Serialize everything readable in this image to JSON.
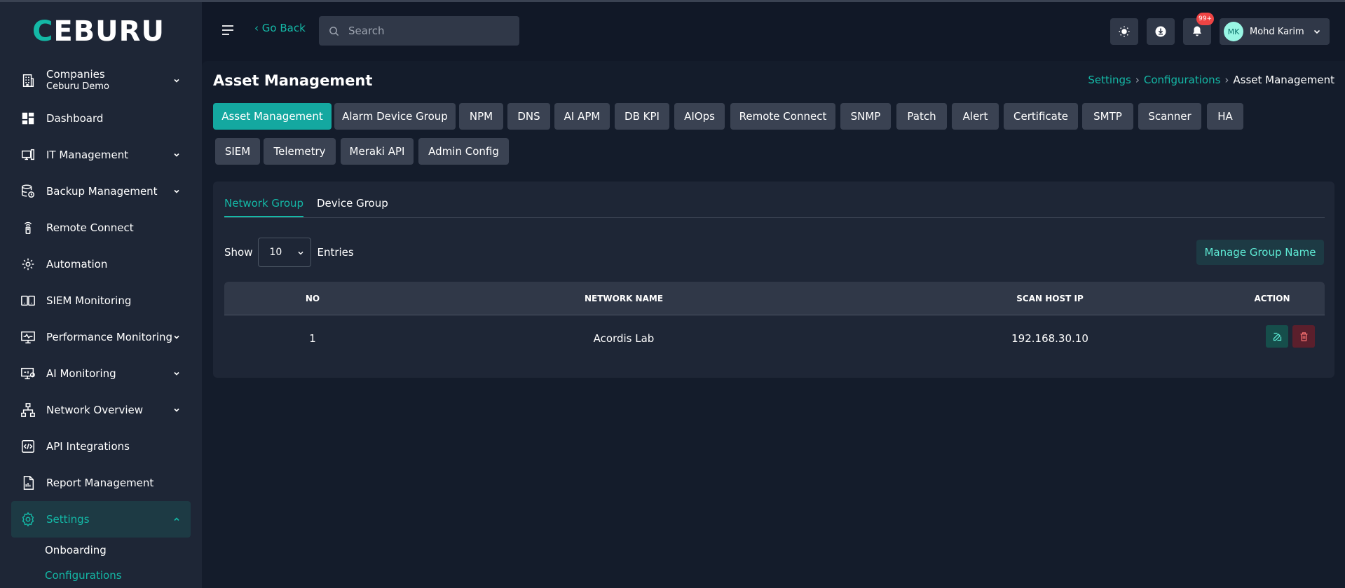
{
  "app": {
    "logo": "CEBURU"
  },
  "sidebar": {
    "companies_label": "Companies",
    "companies_sub": "Ceburu Demo",
    "items": [
      {
        "label": "Dashboard"
      },
      {
        "label": "IT Management"
      },
      {
        "label": "Backup Management"
      },
      {
        "label": "Remote Connect"
      },
      {
        "label": "Automation"
      },
      {
        "label": "SIEM Monitoring"
      },
      {
        "label": "Performance Monitoring"
      },
      {
        "label": "AI Monitoring"
      },
      {
        "label": "Network Overview"
      },
      {
        "label": "API Integrations"
      },
      {
        "label": "Report Management"
      },
      {
        "label": "Settings"
      }
    ],
    "settings_sub": [
      {
        "label": "Onboarding"
      },
      {
        "label": "Configurations"
      }
    ]
  },
  "topbar": {
    "go_back": "‹ Go Back",
    "search_placeholder": "Search",
    "notification_badge": "99+",
    "user_initials": "MK",
    "user_name": "Mohd Karim"
  },
  "page": {
    "title": "Asset Management",
    "breadcrumb": [
      "Settings",
      "Configurations",
      "Asset Management"
    ]
  },
  "config_tabs": [
    "Asset Management",
    "Alarm Device Group",
    "NPM",
    "DNS",
    "AI APM",
    "DB KPI",
    "AIOps",
    "Remote Connect",
    "SNMP",
    "Patch",
    "Alert",
    "Certificate",
    "SMTP",
    "Scanner",
    "HA",
    "SIEM",
    "Telemetry",
    "Meraki API",
    "Admin Config"
  ],
  "card": {
    "tabs": [
      "Network Group",
      "Device Group"
    ],
    "show_label": "Show",
    "entries_value": "10",
    "entries_label": "Entries",
    "manage_button": "Manage Group Name",
    "table": {
      "headers": [
        "NO",
        "NETWORK NAME",
        "SCAN HOST IP",
        "ACTION"
      ],
      "rows": [
        {
          "no": "1",
          "network_name": "Acordis Lab",
          "scan_host_ip": "192.168.30.10"
        }
      ]
    }
  },
  "colors": {
    "accent": "#14b8a6",
    "danger": "#ef4444"
  }
}
